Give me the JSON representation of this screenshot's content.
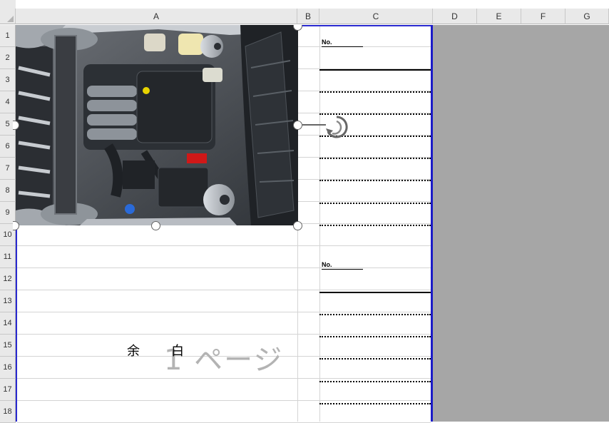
{
  "columns": [
    "A",
    "B",
    "C",
    "D",
    "E",
    "F",
    "G"
  ],
  "rows": [
    "1",
    "2",
    "3",
    "4",
    "5",
    "6",
    "7",
    "8",
    "9",
    "10",
    "11",
    "12",
    "13",
    "14",
    "15",
    "16",
    "17",
    "18"
  ],
  "sheet": {
    "no_label_1": "No.",
    "no_label_2": "No.",
    "margin_label_1": "余",
    "margin_label_2": "白",
    "page_watermark": "1 ページ"
  },
  "picture": {
    "name": "engine-bay-photo",
    "colors": {
      "body": "#3a3f45",
      "silver": "#b8bcc2",
      "accent_red": "#d01818",
      "accent_yellow": "#e8d400",
      "accent_blue": "#2a6ad8"
    }
  },
  "colors": {
    "header_bg": "#e9e9e9",
    "page_break": "#1c1cc8",
    "outside_print_area": "#a6a6a6"
  }
}
